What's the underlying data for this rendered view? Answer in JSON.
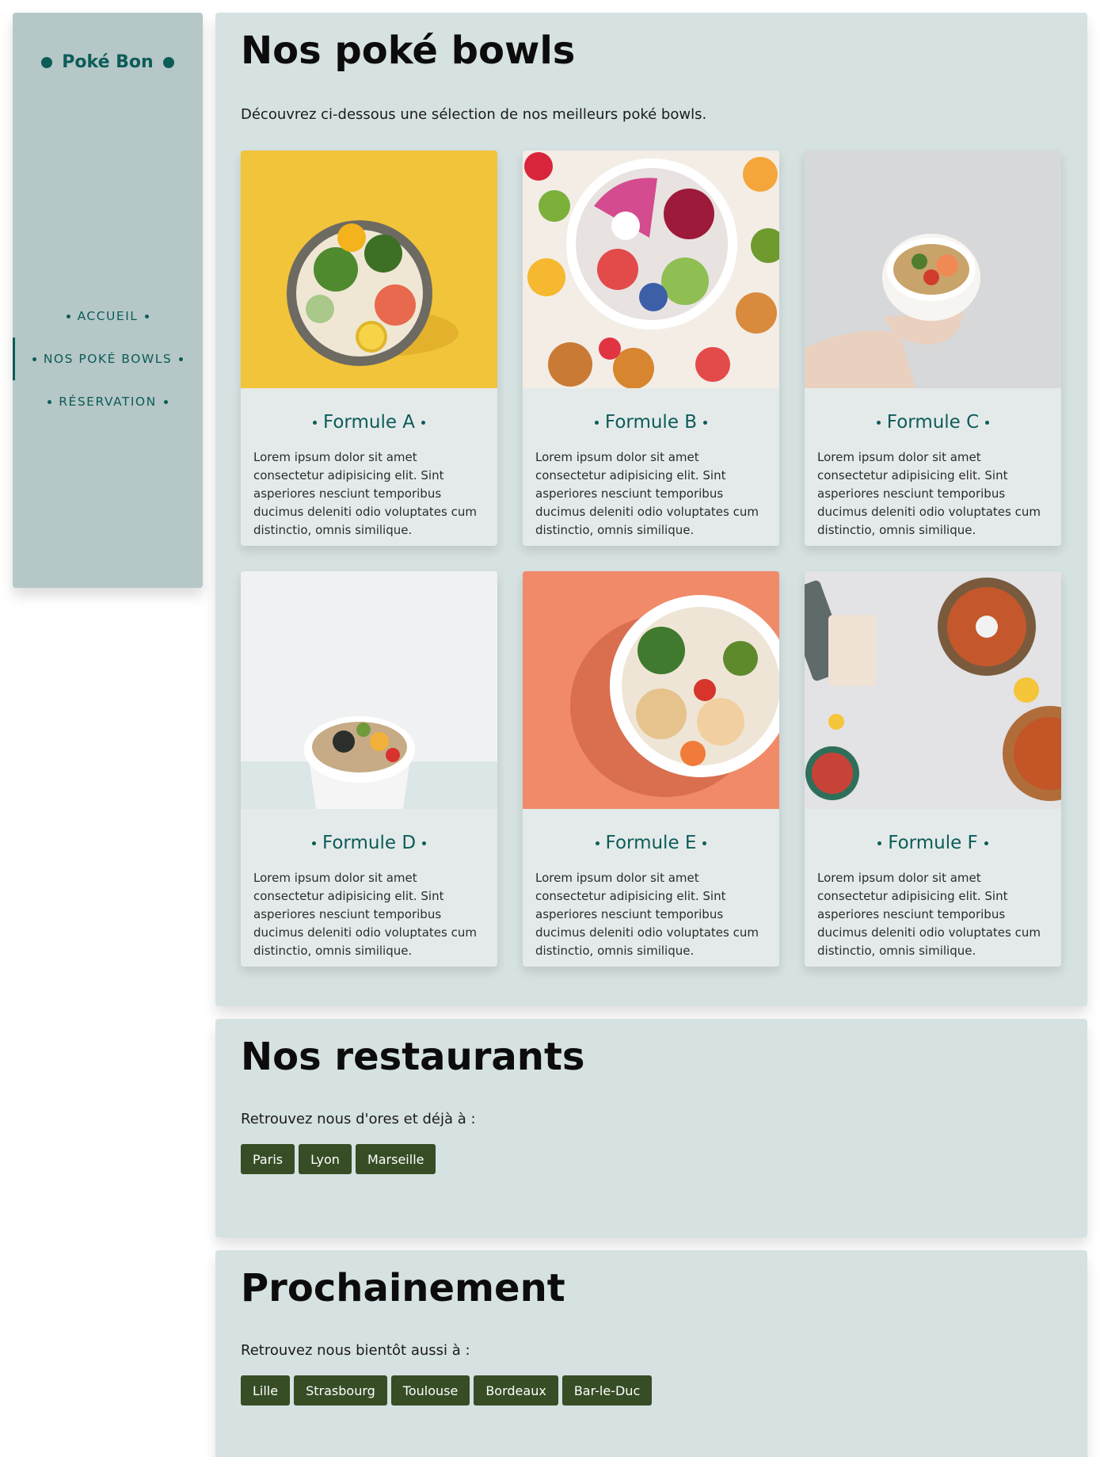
{
  "brand": {
    "name": "Poké Bon"
  },
  "nav": {
    "items": [
      {
        "label": "ACCUEIL"
      },
      {
        "label": "NOS POKÉ BOWLS"
      },
      {
        "label": "RÉSERVATION"
      }
    ]
  },
  "bowls": {
    "title": "Nos poké bowls",
    "intro": "Découvrez ci-dessous une sélection de nos meilleurs poké bowls.",
    "cards": [
      {
        "title": "Formule A",
        "text": "Lorem ipsum dolor sit amet consectetur adipisicing elit. Sint asperiores nesciunt temporibus ducimus deleniti odio voluptates cum distinctio, omnis similique."
      },
      {
        "title": "Formule B",
        "text": "Lorem ipsum dolor sit amet consectetur adipisicing elit. Sint asperiores nesciunt temporibus ducimus deleniti odio voluptates cum distinctio, omnis similique."
      },
      {
        "title": "Formule C",
        "text": "Lorem ipsum dolor sit amet consectetur adipisicing elit. Sint asperiores nesciunt temporibus ducimus deleniti odio voluptates cum distinctio, omnis similique."
      },
      {
        "title": "Formule D",
        "text": "Lorem ipsum dolor sit amet consectetur adipisicing elit. Sint asperiores nesciunt temporibus ducimus deleniti odio voluptates cum distinctio, omnis similique."
      },
      {
        "title": "Formule E",
        "text": "Lorem ipsum dolor sit amet consectetur adipisicing elit. Sint asperiores nesciunt temporibus ducimus deleniti odio voluptates cum distinctio, omnis similique."
      },
      {
        "title": "Formule F",
        "text": "Lorem ipsum dolor sit amet consectetur adipisicing elit. Sint asperiores nesciunt temporibus ducimus deleniti odio voluptates cum distinctio, omnis similique."
      }
    ]
  },
  "restaurants": {
    "title": "Nos restaurants",
    "intro": "Retrouvez nous d'ores et déjà à :",
    "cities": [
      "Paris",
      "Lyon",
      "Marseille"
    ]
  },
  "upcoming": {
    "title": "Prochainement",
    "intro": "Retrouvez nous bientôt aussi à :",
    "cities": [
      "Lille",
      "Strasbourg",
      "Toulouse",
      "Bordeaux",
      "Bar-le-Duc"
    ]
  },
  "colors": {
    "accent": "#0c5c58",
    "sidebar_bg": "#b6c7c7",
    "section_bg": "#d6e1e1",
    "card_bg": "#e4eaea",
    "tag_bg": "#364d25"
  }
}
